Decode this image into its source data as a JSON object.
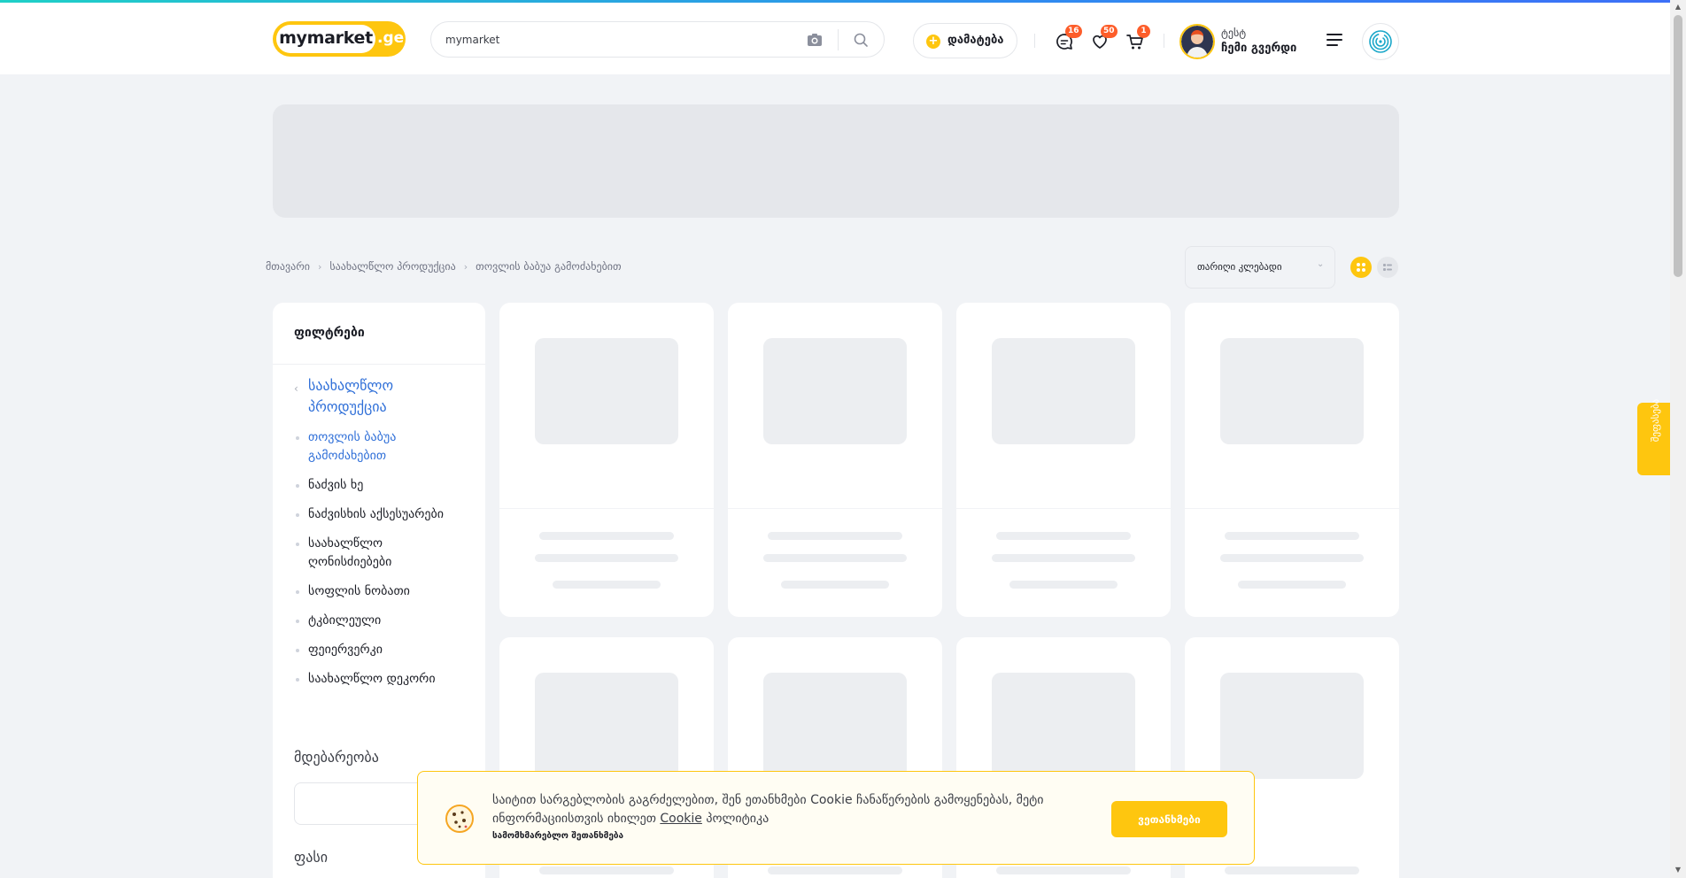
{
  "header": {
    "logo_main": "mymarket",
    "logo_tld": ".ge",
    "search_value": "mymarket",
    "add_label": "დამატება",
    "badges": {
      "messages": "16",
      "favorites": "50",
      "cart": "1"
    },
    "user_name": "ტესტ",
    "user_link": "ჩემი გვერდი"
  },
  "breadcrumb": [
    "მთავარი",
    "საახალწლო პროდუქცია",
    "თოვლის ბაბუა გამოძახებით"
  ],
  "sort": {
    "label": "თარიღი კლებადი"
  },
  "sidebar": {
    "title": "ფილტრები",
    "parent_category": "საახალწლო პროდუქცია",
    "current_category": "თოვლის ბაბუა გამოძახებით",
    "categories": [
      "ნაძვის ხე",
      "ნაძვისხის აქსესუარები",
      "საახალწლო ღონისძიებები",
      "სოფლის ნობათი",
      "ტკბილეული",
      "ფეიერვერკი",
      "საახალწლო დეკორი"
    ],
    "location_label": "მდებარეობა",
    "price_label": "ფასი"
  },
  "side_tab": {
    "label": "შეფასება"
  },
  "cookie": {
    "text_part1": "საიტით სარგებლობის გაგრძელებით, შენ ეთანხმები Cookie ჩანაწერების გამოყენებას, მეტი ინფორმაციისთვის იხილეთ ",
    "link": "Cookie",
    "text_part2": " პოლიტიკა",
    "terms": "სამომხმარებლო შეთანხმება",
    "agree": "ვეთანხმები"
  },
  "colors": {
    "accent": "#fec60f",
    "link": "#2f6fd8",
    "badge": "#fd5d2a",
    "background": "#f1f3f6"
  },
  "icons": [
    "camera-icon",
    "search-icon",
    "plus-icon",
    "chat-icon",
    "heart-icon",
    "cart-icon",
    "menu-icon",
    "fingerprint-icon",
    "cookie-icon",
    "grid-view-icon",
    "list-view-icon"
  ]
}
